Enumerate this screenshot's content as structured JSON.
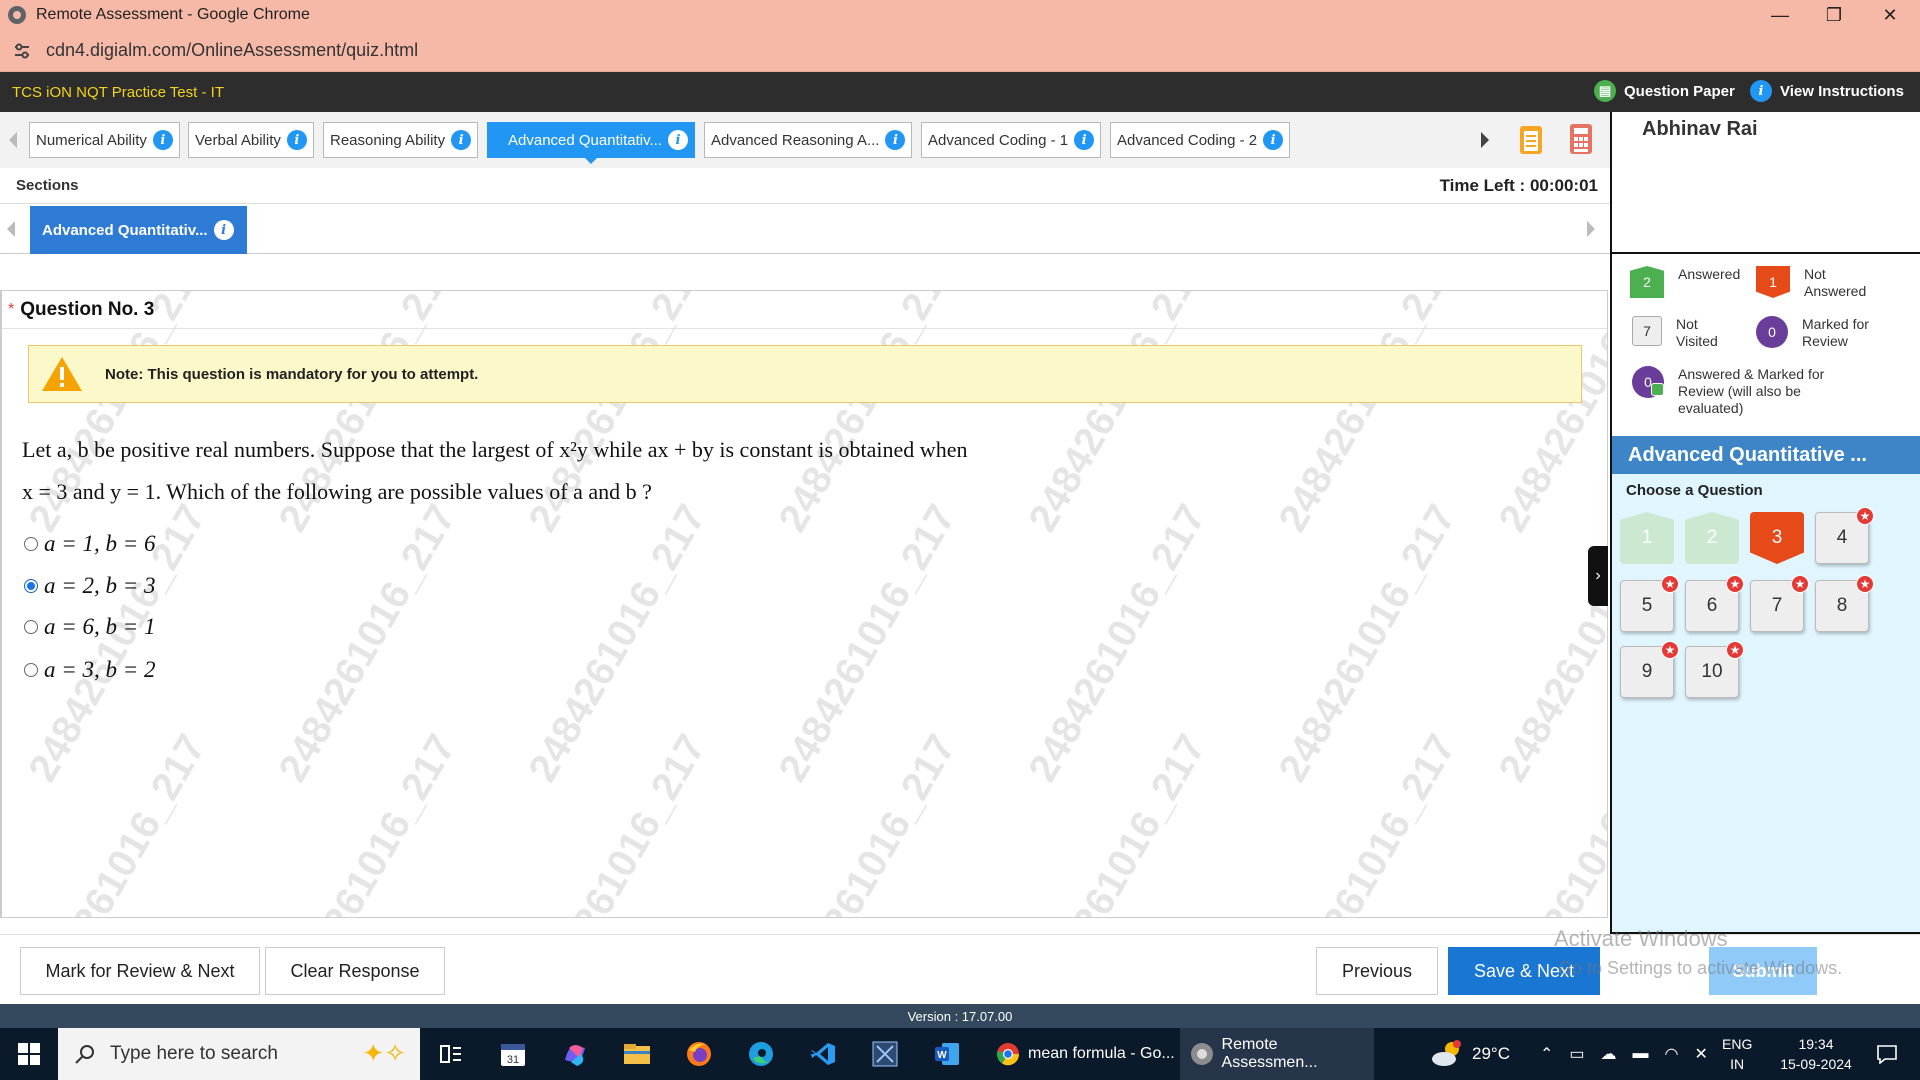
{
  "browser": {
    "window_title": "Remote Assessment - Google Chrome",
    "url": "cdn4.digialm.com/OnlineAssessment/quiz.html",
    "controls": {
      "minimize": "—",
      "maximize": "❐",
      "close": "✕"
    }
  },
  "header": {
    "app_title": "TCS iON NQT Practice Test - IT",
    "question_paper": "Question Paper",
    "view_instructions": "View Instructions"
  },
  "section_tabs": [
    {
      "label": "Numerical Ability"
    },
    {
      "label": "Verbal Ability"
    },
    {
      "label": "Reasoning Ability"
    },
    {
      "label": "Advanced Quantitativ..."
    },
    {
      "label": "Advanced Reasoning A..."
    },
    {
      "label": "Advanced Coding - 1"
    },
    {
      "label": "Advanced Coding - 2"
    }
  ],
  "sections_label": "Sections",
  "time_left": "Time Left : 00:00:01",
  "active_subsection": "Advanced Quantitativ...",
  "question": {
    "star": "*",
    "number_label": "Question No. 3",
    "note": "Note: This question is mandatory for you to attempt.",
    "text_line1": "Let a, b be positive real numbers. Suppose that the largest of x²y while ax + by  is constant is obtained when",
    "text_line2": "x = 3 and y = 1. Which of the following are possible values of a and b ?",
    "options": [
      {
        "label": "a = 1, b = 6",
        "selected": false
      },
      {
        "label": "a = 2, b = 3",
        "selected": true
      },
      {
        "label": "a = 6, b = 1",
        "selected": false
      },
      {
        "label": "a = 3, b = 2",
        "selected": false
      }
    ],
    "watermark": "2484261016_217"
  },
  "candidate": {
    "name": "Abhinav Rai"
  },
  "legend": {
    "answered": {
      "count": "2",
      "label": "Answered"
    },
    "not_answered": {
      "count": "1",
      "label": "Not Answered"
    },
    "not_visited": {
      "count": "7",
      "label": "Not Visited"
    },
    "marked": {
      "count": "0",
      "label": "Marked for Review"
    },
    "answered_marked": {
      "count": "0",
      "label": "Answered & Marked for Review (will also be evaluated)"
    }
  },
  "palette": {
    "section_title": "Advanced Quantitative ...",
    "choose_label": "Choose a Question",
    "questions": [
      {
        "n": "1",
        "state": "answered"
      },
      {
        "n": "2",
        "state": "answered"
      },
      {
        "n": "3",
        "state": "current"
      },
      {
        "n": "4",
        "state": "not_visited"
      },
      {
        "n": "5",
        "state": "not_visited"
      },
      {
        "n": "6",
        "state": "not_visited"
      },
      {
        "n": "7",
        "state": "not_visited"
      },
      {
        "n": "8",
        "state": "not_visited"
      },
      {
        "n": "9",
        "state": "not_visited"
      },
      {
        "n": "10",
        "state": "not_visited"
      }
    ]
  },
  "actions": {
    "mark_review_next": "Mark for Review & Next",
    "clear_response": "Clear Response",
    "previous": "Previous",
    "save_next": "Save & Next",
    "submit": "Submit"
  },
  "activation": {
    "line1": "Activate Windows",
    "line2": "Go to Settings to activate Windows."
  },
  "version": "Version : 17.07.00",
  "taskbar": {
    "search_placeholder": "Type here to search",
    "task_chrome1": "mean formula - Go...",
    "task_chrome2": "Remote Assessmen...",
    "weather": "29°C",
    "lang1": "ENG",
    "lang2": "IN",
    "time": "19:34",
    "date": "15-09-2024"
  },
  "colors": {
    "accent": "#2196f3",
    "answered": "#4caf50",
    "not_answered": "#e64a19",
    "marked": "#6a3d9a",
    "header_bg": "#2d2d2d",
    "app_title": "#f2d21b"
  }
}
